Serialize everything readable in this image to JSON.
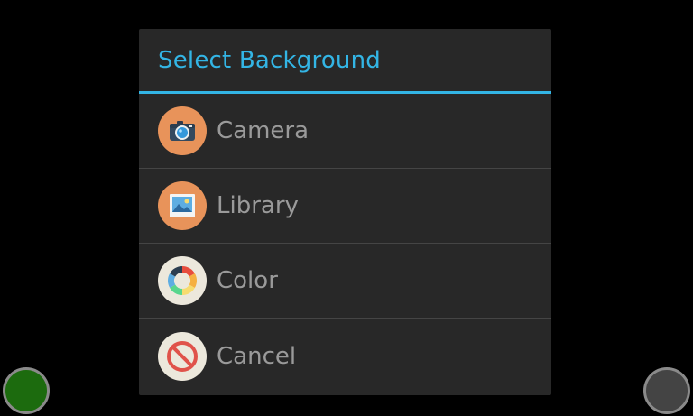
{
  "dialog": {
    "title": "Select Background",
    "accent_color": "#33b5e5",
    "items": [
      {
        "label": "Camera",
        "icon": "camera-icon",
        "icon_bg": "#e8935a"
      },
      {
        "label": "Library",
        "icon": "image-library-icon",
        "icon_bg": "#e8935a"
      },
      {
        "label": "Color",
        "icon": "color-wheel-icon",
        "icon_bg": "#ece8dc"
      },
      {
        "label": "Cancel",
        "icon": "cancel-icon",
        "icon_bg": "#ece8dc"
      }
    ]
  },
  "corner_buttons": {
    "left": {
      "icon": "green-circle-button",
      "color": "#1c6b0e"
    },
    "right": {
      "icon": "gray-circle-button",
      "color": "#444444"
    }
  }
}
